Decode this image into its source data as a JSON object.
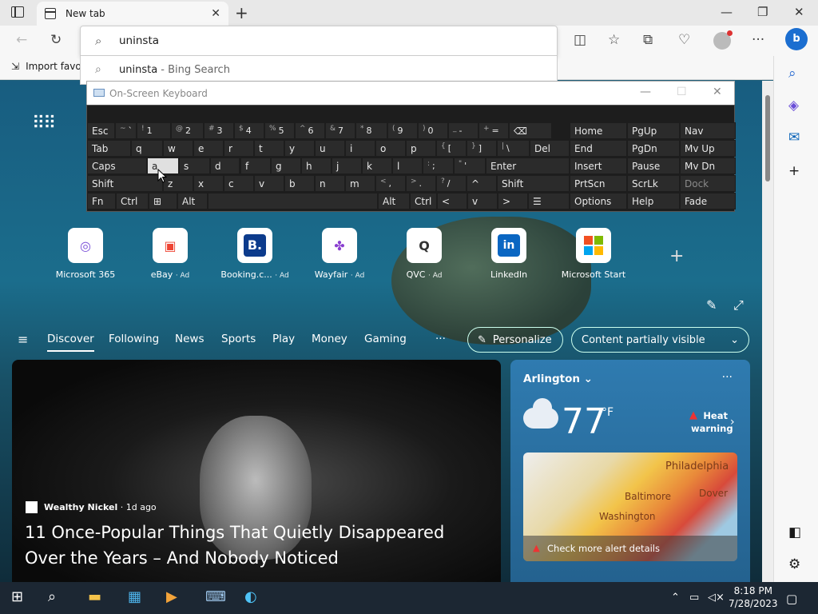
{
  "browser": {
    "tab_title": "New tab",
    "address_value": "uninsta",
    "suggestion_query": "uninsta",
    "suggestion_source": " - Bing Search",
    "favorites_import": "Import favo"
  },
  "osk": {
    "title": "On-Screen Keyboard",
    "rows": [
      [
        {
          "l": "Esc"
        },
        {
          "s": "~",
          "l": "`"
        },
        {
          "s": "!",
          "l": "1"
        },
        {
          "s": "@",
          "l": "2"
        },
        {
          "s": "#",
          "l": "3"
        },
        {
          "s": "$",
          "l": "4"
        },
        {
          "s": "%",
          "l": "5"
        },
        {
          "s": "^",
          "l": "6"
        },
        {
          "s": "&",
          "l": "7"
        },
        {
          "s": "*",
          "l": "8"
        },
        {
          "s": "(",
          "l": "9"
        },
        {
          "s": ")",
          "l": "0"
        },
        {
          "s": "_",
          "l": "-"
        },
        {
          "s": "+",
          "l": "="
        },
        {
          "l": "⌫"
        }
      ],
      [
        {
          "l": "Tab"
        },
        {
          "l": "q"
        },
        {
          "l": "w"
        },
        {
          "l": "e"
        },
        {
          "l": "r"
        },
        {
          "l": "t"
        },
        {
          "l": "y"
        },
        {
          "l": "u"
        },
        {
          "l": "i"
        },
        {
          "l": "o"
        },
        {
          "l": "p"
        },
        {
          "s": "{",
          "l": "["
        },
        {
          "s": "}",
          "l": "]"
        },
        {
          "s": "|",
          "l": "\\"
        },
        {
          "l": "Del"
        }
      ],
      [
        {
          "l": "Caps"
        },
        {
          "l": "a"
        },
        {
          "l": "s"
        },
        {
          "l": "d"
        },
        {
          "l": "f"
        },
        {
          "l": "g"
        },
        {
          "l": "h"
        },
        {
          "l": "j"
        },
        {
          "l": "k"
        },
        {
          "l": "l"
        },
        {
          "s": ":",
          "l": ";"
        },
        {
          "s": "\"",
          "l": "'"
        },
        {
          "l": "Enter"
        }
      ],
      [
        {
          "l": "Shift"
        },
        {
          "l": "z"
        },
        {
          "l": "x"
        },
        {
          "l": "c"
        },
        {
          "l": "v"
        },
        {
          "l": "b"
        },
        {
          "l": "n"
        },
        {
          "l": "m"
        },
        {
          "s": "<",
          "l": ","
        },
        {
          "s": ">",
          "l": "."
        },
        {
          "s": "?",
          "l": "/"
        },
        {
          "l": "^"
        },
        {
          "l": "Shift"
        }
      ],
      [
        {
          "l": "Fn"
        },
        {
          "l": "Ctrl"
        },
        {
          "l": "⊞"
        },
        {
          "l": "Alt"
        },
        {
          "l": ""
        },
        {
          "l": "Alt"
        },
        {
          "l": "Ctrl"
        },
        {
          "l": "<"
        },
        {
          "l": "v"
        },
        {
          "l": ">"
        },
        {
          "l": "☰"
        }
      ]
    ],
    "nav": [
      [
        "Home",
        "PgUp",
        "Nav"
      ],
      [
        "End",
        "PgDn",
        "Mv Up"
      ],
      [
        "Insert",
        "Pause",
        "Mv Dn"
      ],
      [
        "PrtScn",
        "ScrLk",
        "Dock"
      ],
      [
        "Options",
        "Help",
        "Fade"
      ]
    ]
  },
  "quicklinks": [
    {
      "name": "Microsoft 365",
      "ad": ""
    },
    {
      "name": "eBay",
      "ad": "· Ad"
    },
    {
      "name": "Booking.c...",
      "ad": "· Ad"
    },
    {
      "name": "Wayfair",
      "ad": "· Ad"
    },
    {
      "name": "QVC",
      "ad": "· Ad"
    },
    {
      "name": "LinkedIn",
      "ad": ""
    },
    {
      "name": "Microsoft Start",
      "ad": ""
    }
  ],
  "feed_nav": {
    "items": [
      "Discover",
      "Following",
      "News",
      "Sports",
      "Play",
      "Money",
      "Gaming"
    ],
    "more": "···",
    "personalize": "Personalize",
    "visibility": "Content partially visible"
  },
  "hero": {
    "source": "Wealthy Nickel",
    "age": " · 1d ago",
    "headline": "11 Once-Popular Things That Quietly Disappeared Over the Years – And Nobody Noticed"
  },
  "weather": {
    "city": "Arlington",
    "temp": "77",
    "unit": "°F",
    "warning": "Heat warning",
    "map_labels": [
      "Philadelphia",
      "Baltimore",
      "Washington",
      "Dover"
    ],
    "alert": "Check more alert details"
  },
  "taskbar": {
    "time": "8:18 PM",
    "date": "7/28/2023"
  },
  "colors": {
    "accent": "#1b6ed0",
    "taskbar": "#1c2733",
    "osk_bg": "#1d1d1d",
    "heat_alert": "#dd3333"
  }
}
